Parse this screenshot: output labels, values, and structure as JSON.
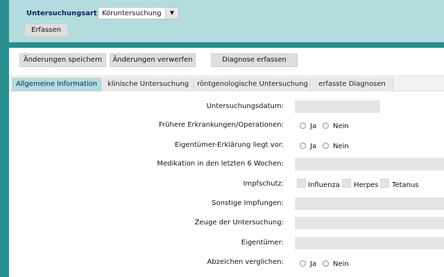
{
  "header": {
    "art_label": "Untersuchungsart:",
    "art_value": "Köruntersuchung",
    "erfassen_label": "Erfassen"
  },
  "actions": {
    "save": "Änderungen speichern",
    "discard": "Änderungen verwerfen",
    "diagnose": "Diagnose erfassen"
  },
  "tabs": [
    {
      "label": "Allgemeine Information",
      "active": true
    },
    {
      "label": "klinische Untersuchung",
      "active": false
    },
    {
      "label": "röntgenologische Untersuchung",
      "active": false
    },
    {
      "label": "erfasste Diagnosen",
      "active": false
    }
  ],
  "form": {
    "datum_label": "Untersuchungsdatum:",
    "datum_value": "",
    "erkrankungen_label": "Frühere Erkrankungen/Operationen:",
    "erklaerung_label": "Eigentümer-Erklärung liegt vor:",
    "medikation_label": "Medikation in den letzten 6 Wochen:",
    "medikation_value": "",
    "impfschutz_label": "Impfschutz:",
    "impf_influenza": "Influenza",
    "impf_herpes": "Herpes",
    "impf_tetanus": "Tetanus",
    "sonstige_label": "Sonstige Impfungen:",
    "sonstige_value": "",
    "zeuge_label": "Zeuge der Untersuchung:",
    "zeuge_value": "",
    "eigentuemer_label": "Eigentümer:",
    "eigentuemer_value": "",
    "abzeichen_label": "Abzeichen verglichen:",
    "ja": "Ja",
    "nein": "Nein"
  },
  "colors": {
    "header_bg": "#b2dcdd",
    "accent": "#2a8f8f",
    "label_blue": "#0d1f5a"
  },
  "icons": [
    "chevron-down-icon"
  ]
}
